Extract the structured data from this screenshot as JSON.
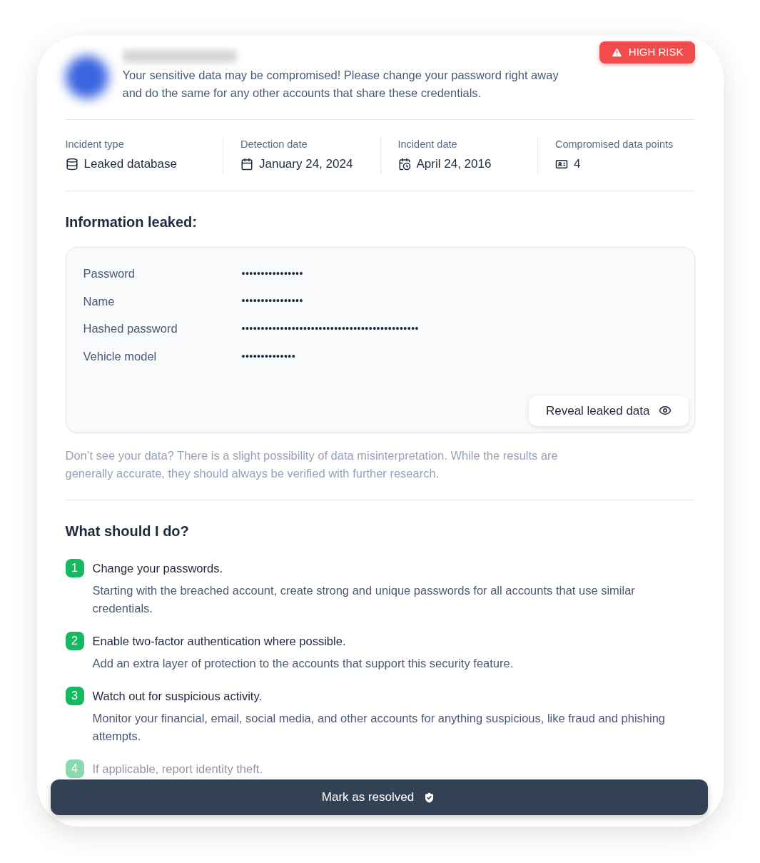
{
  "risk_badge": "HIGH RISK",
  "message": "Your sensitive data may be compromised! Please change your password right away and do the same for any other accounts that share these credentials.",
  "details": [
    {
      "kind": "database",
      "label": "Incident type",
      "value": "Leaked database"
    },
    {
      "kind": "calendar",
      "label": "Detection date",
      "value": "January 24, 2024"
    },
    {
      "kind": "calendar-clock",
      "label": "Incident date",
      "value": "April 24, 2016"
    },
    {
      "kind": "id-card",
      "label": "Compromised data points",
      "value": "4"
    }
  ],
  "leaked_heading": "Information leaked:",
  "leaked_fields": [
    {
      "label": "Password",
      "value": "••••••••••••••••"
    },
    {
      "label": "Name",
      "value": "••••••••••••••••"
    },
    {
      "label": "Hashed password",
      "value": "••••••••••••••••••••••••••••••••••••••••••••••"
    },
    {
      "label": "Vehicle model",
      "value": "••••••••••••••"
    }
  ],
  "reveal_button": "Reveal leaked data",
  "disclaimer": "Don’t see your data? There is a slight possibility of data misinterpretation. While the results are generally accurate, they should always be verified with further research.",
  "steps_heading": "What should I do?",
  "steps": [
    {
      "number": "1",
      "title": "Change your passwords.",
      "description": "Starting with the breached account, create strong and unique passwords for all accounts that use similar credentials."
    },
    {
      "number": "2",
      "title": "Enable two-factor authentication where possible.",
      "description": "Add an extra layer of protection to the accounts that support this security feature."
    },
    {
      "number": "3",
      "title": "Watch out for suspicious activity.",
      "description": "Monitor your financial, email, social media, and other accounts for anything suspicious, like fraud and phishing attempts."
    },
    {
      "number": "4",
      "title": "If applicable, report identity theft."
    }
  ],
  "resolve_button": "Mark as resolved"
}
